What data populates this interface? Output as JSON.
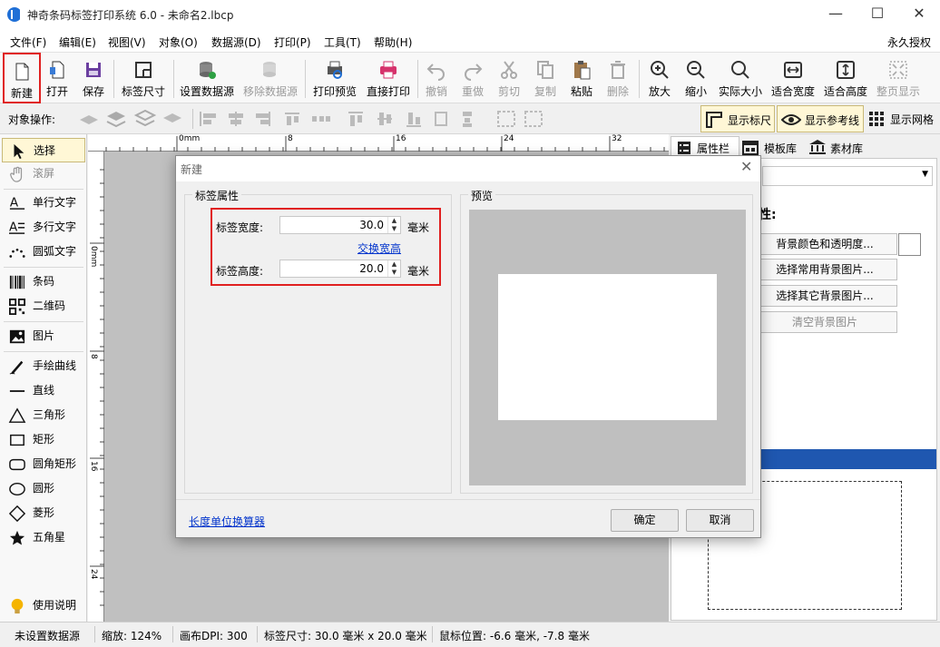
{
  "window": {
    "title": "神奇条码标签打印系统 6.0 - 未命名2.lbcp",
    "min": "—",
    "max": "☐",
    "close": "✕"
  },
  "menu": [
    "文件(F)",
    "编辑(E)",
    "视图(V)",
    "对象(O)",
    "数据源(D)",
    "打印(P)",
    "工具(T)",
    "帮助(H)"
  ],
  "license": "永久授权",
  "toolbar": {
    "new": "新建",
    "open": "打开",
    "save": "保存",
    "label_size": "标签尺寸",
    "set_datasource": "设置数据源",
    "remove_datasource": "移除数据源",
    "print_preview": "打印预览",
    "direct_print": "直接打印",
    "undo": "撤销",
    "redo": "重做",
    "cut": "剪切",
    "copy": "复制",
    "paste": "粘贴",
    "delete": "删除",
    "zoom_in": "放大",
    "zoom_out": "缩小",
    "actual_size": "实际大小",
    "fit_width": "适合宽度",
    "fit_height": "适合高度",
    "whole_page": "整页显示"
  },
  "objbar": {
    "label": "对象操作:",
    "show_ruler": "显示标尺",
    "show_guides": "显示参考线",
    "show_grid": "显示网格"
  },
  "tools": [
    "选择",
    "滚屏",
    "单行文字",
    "多行文字",
    "圆弧文字",
    "条码",
    "二维码",
    "图片",
    "手绘曲线",
    "直线",
    "三角形",
    "矩形",
    "圆角矩形",
    "圆形",
    "菱形",
    "五角星"
  ],
  "help": "使用说明",
  "ruler": {
    "top": [
      "0mm",
      "8",
      "16",
      "24",
      "32"
    ],
    "left": [
      "0mm",
      "8",
      "16",
      "24"
    ]
  },
  "rpanel": {
    "tabs": [
      "属性栏",
      "模板库",
      "素材库"
    ],
    "heading": "性:",
    "buttons": [
      "背景颜色和透明度...",
      "选择常用背景图片...",
      "选择其它背景图片...",
      "清空背景图片"
    ]
  },
  "dialog": {
    "title": "新建",
    "group_props": "标签属性",
    "group_preview": "预览",
    "width_label": "标签宽度:",
    "width_value": "30.0",
    "height_label": "标签高度:",
    "height_value": "20.0",
    "unit": "毫米",
    "swap": "交换宽高",
    "calc": "长度单位换算器",
    "ok": "确定",
    "cancel": "取消"
  },
  "status": {
    "datasource": "未设置数据源",
    "zoom": "缩放: 124%",
    "dpi": "画布DPI: 300",
    "size": "标签尺寸: 30.0 毫米 x 20.0 毫米",
    "mouse": "鼠标位置: -6.6 毫米, -7.8 毫米"
  },
  "colors": {
    "accent": "#1f6fd6",
    "highlight": "#e02020",
    "selection": "#1f57b0"
  }
}
